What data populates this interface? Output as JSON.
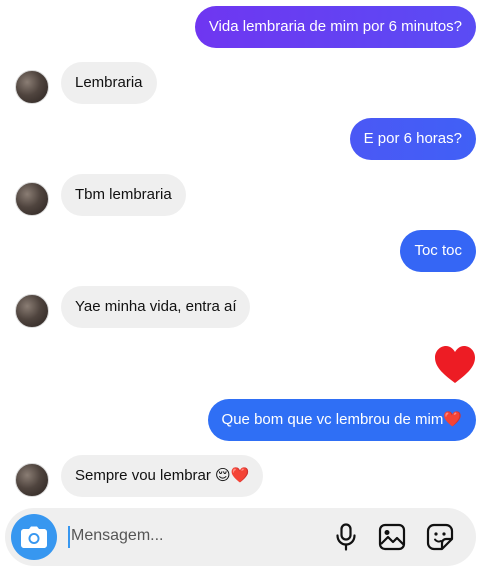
{
  "colors": {
    "outgoing_gradient_start": "#6f36f1",
    "outgoing_gradient_end": "#3d63f6",
    "outgoing_blue": "#2f6ff5",
    "incoming_bg": "#efefef",
    "camera_blue": "#3797f0",
    "heart_red": "#ed1c24"
  },
  "messages": [
    {
      "side": "out",
      "text": "Vida lembraria de mim por 6 minutos?"
    },
    {
      "side": "in",
      "text": "Lembraria"
    },
    {
      "side": "out",
      "text": "E por 6 horas?"
    },
    {
      "side": "in",
      "text": "Tbm lembraria"
    },
    {
      "side": "out",
      "text": "Toc toc"
    },
    {
      "side": "in",
      "text": "Yae minha vida, entra aí"
    },
    {
      "side": "out",
      "emoji": "heart"
    },
    {
      "side": "out",
      "text": "Que bom que vc lembrou de mim❤️"
    },
    {
      "side": "in",
      "text": "Sempre vou lembrar 😌❤️"
    }
  ],
  "composer": {
    "placeholder": "Mensagem...",
    "icons": [
      "camera-icon",
      "microphone-icon",
      "gallery-icon",
      "sticker-icon"
    ]
  }
}
